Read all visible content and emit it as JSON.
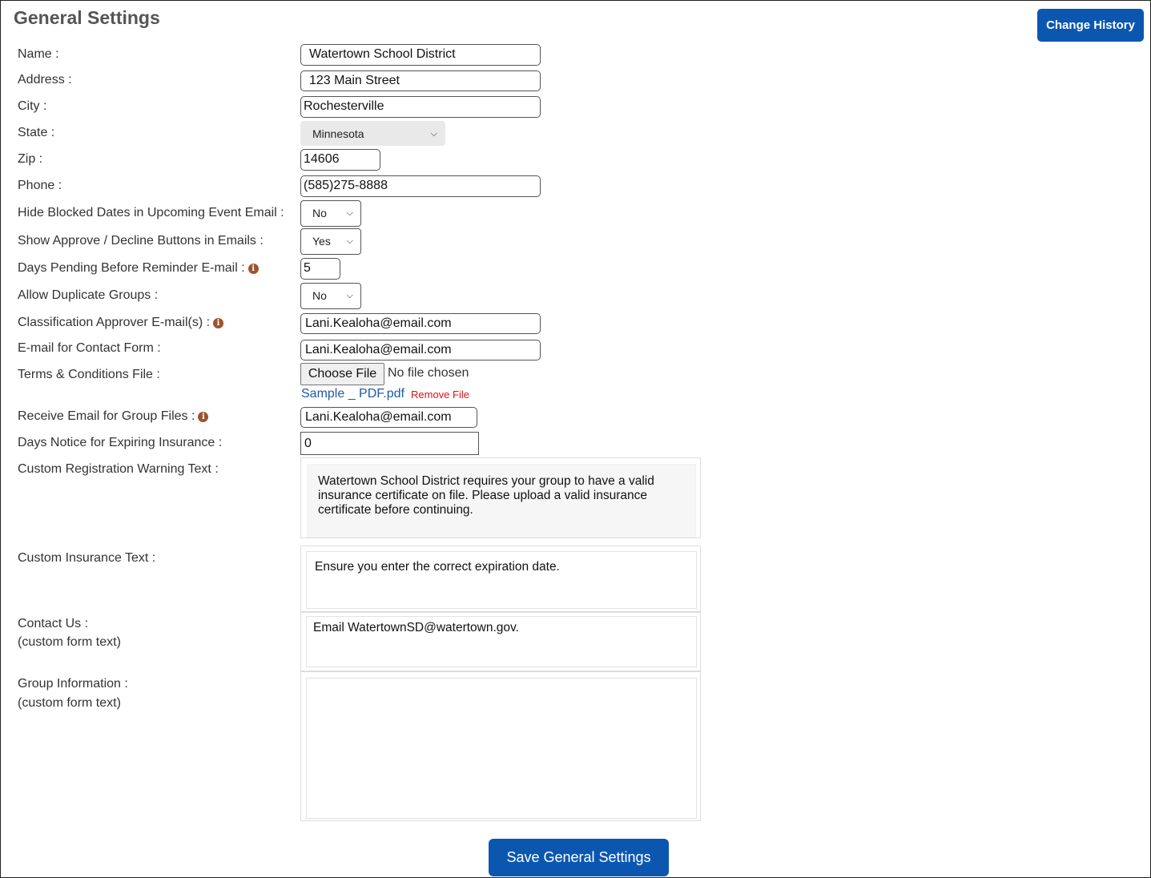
{
  "page": {
    "title": "General Settings",
    "change_history_label": "Change History"
  },
  "fields": {
    "name": {
      "label": "Name :",
      "value": "Watertown School District"
    },
    "address": {
      "label": "Address :",
      "value": "123 Main Street"
    },
    "city": {
      "label": "City :",
      "value": "Rochesterville"
    },
    "state": {
      "label": "State :",
      "value": "Minnesota"
    },
    "zip": {
      "label": "Zip :",
      "value": "14606"
    },
    "phone": {
      "label": "Phone :",
      "value": "(585)275-8888"
    },
    "hide_blocked": {
      "label": "Hide Blocked Dates in Upcoming Event Email :",
      "value": "No"
    },
    "show_approve": {
      "label": "Show Approve / Decline Buttons in Emails :",
      "value": "Yes"
    },
    "days_pending": {
      "label": "Days Pending Before Reminder E-mail :",
      "value": "5"
    },
    "allow_duplicate": {
      "label": "Allow Duplicate Groups :",
      "value": "No"
    },
    "classification_email": {
      "label": "Classification Approver E-mail(s) :",
      "value": "Lani.Kealoha@email.com"
    },
    "contact_form_email": {
      "label": "E-mail for Contact Form :",
      "value": "Lani.Kealoha@email.com"
    },
    "terms_file": {
      "label": "Terms & Conditions File :",
      "button": "Choose File",
      "status": "No file chosen",
      "file_name": "Sample _ PDF.pdf",
      "remove": "Remove File"
    },
    "group_files_email": {
      "label": "Receive Email for Group Files :",
      "value": "Lani.Kealoha@email.com"
    },
    "days_notice": {
      "label": "Days Notice for Expiring Insurance :",
      "value": "0"
    },
    "registration_warning": {
      "label": "Custom Registration Warning Text :",
      "value": "Watertown School District requires your group to have a valid insurance certificate on file. Please upload a valid insurance certificate before continuing."
    },
    "insurance_text": {
      "label": "Custom Insurance Text :",
      "value": "Ensure you enter the correct expiration date."
    },
    "contact_us": {
      "label": "Contact Us :",
      "sublabel": "(custom form text)",
      "value": "Email WatertownSD@watertown.gov."
    },
    "group_info": {
      "label": "Group Information :",
      "sublabel": "(custom form text)",
      "value": ""
    }
  },
  "save_label": "Save General Settings",
  "colors": {
    "primary": "#0b57b0",
    "info_icon": "#a0522d",
    "remove_link": "#dd1111",
    "file_link": "#1f5aa8"
  }
}
